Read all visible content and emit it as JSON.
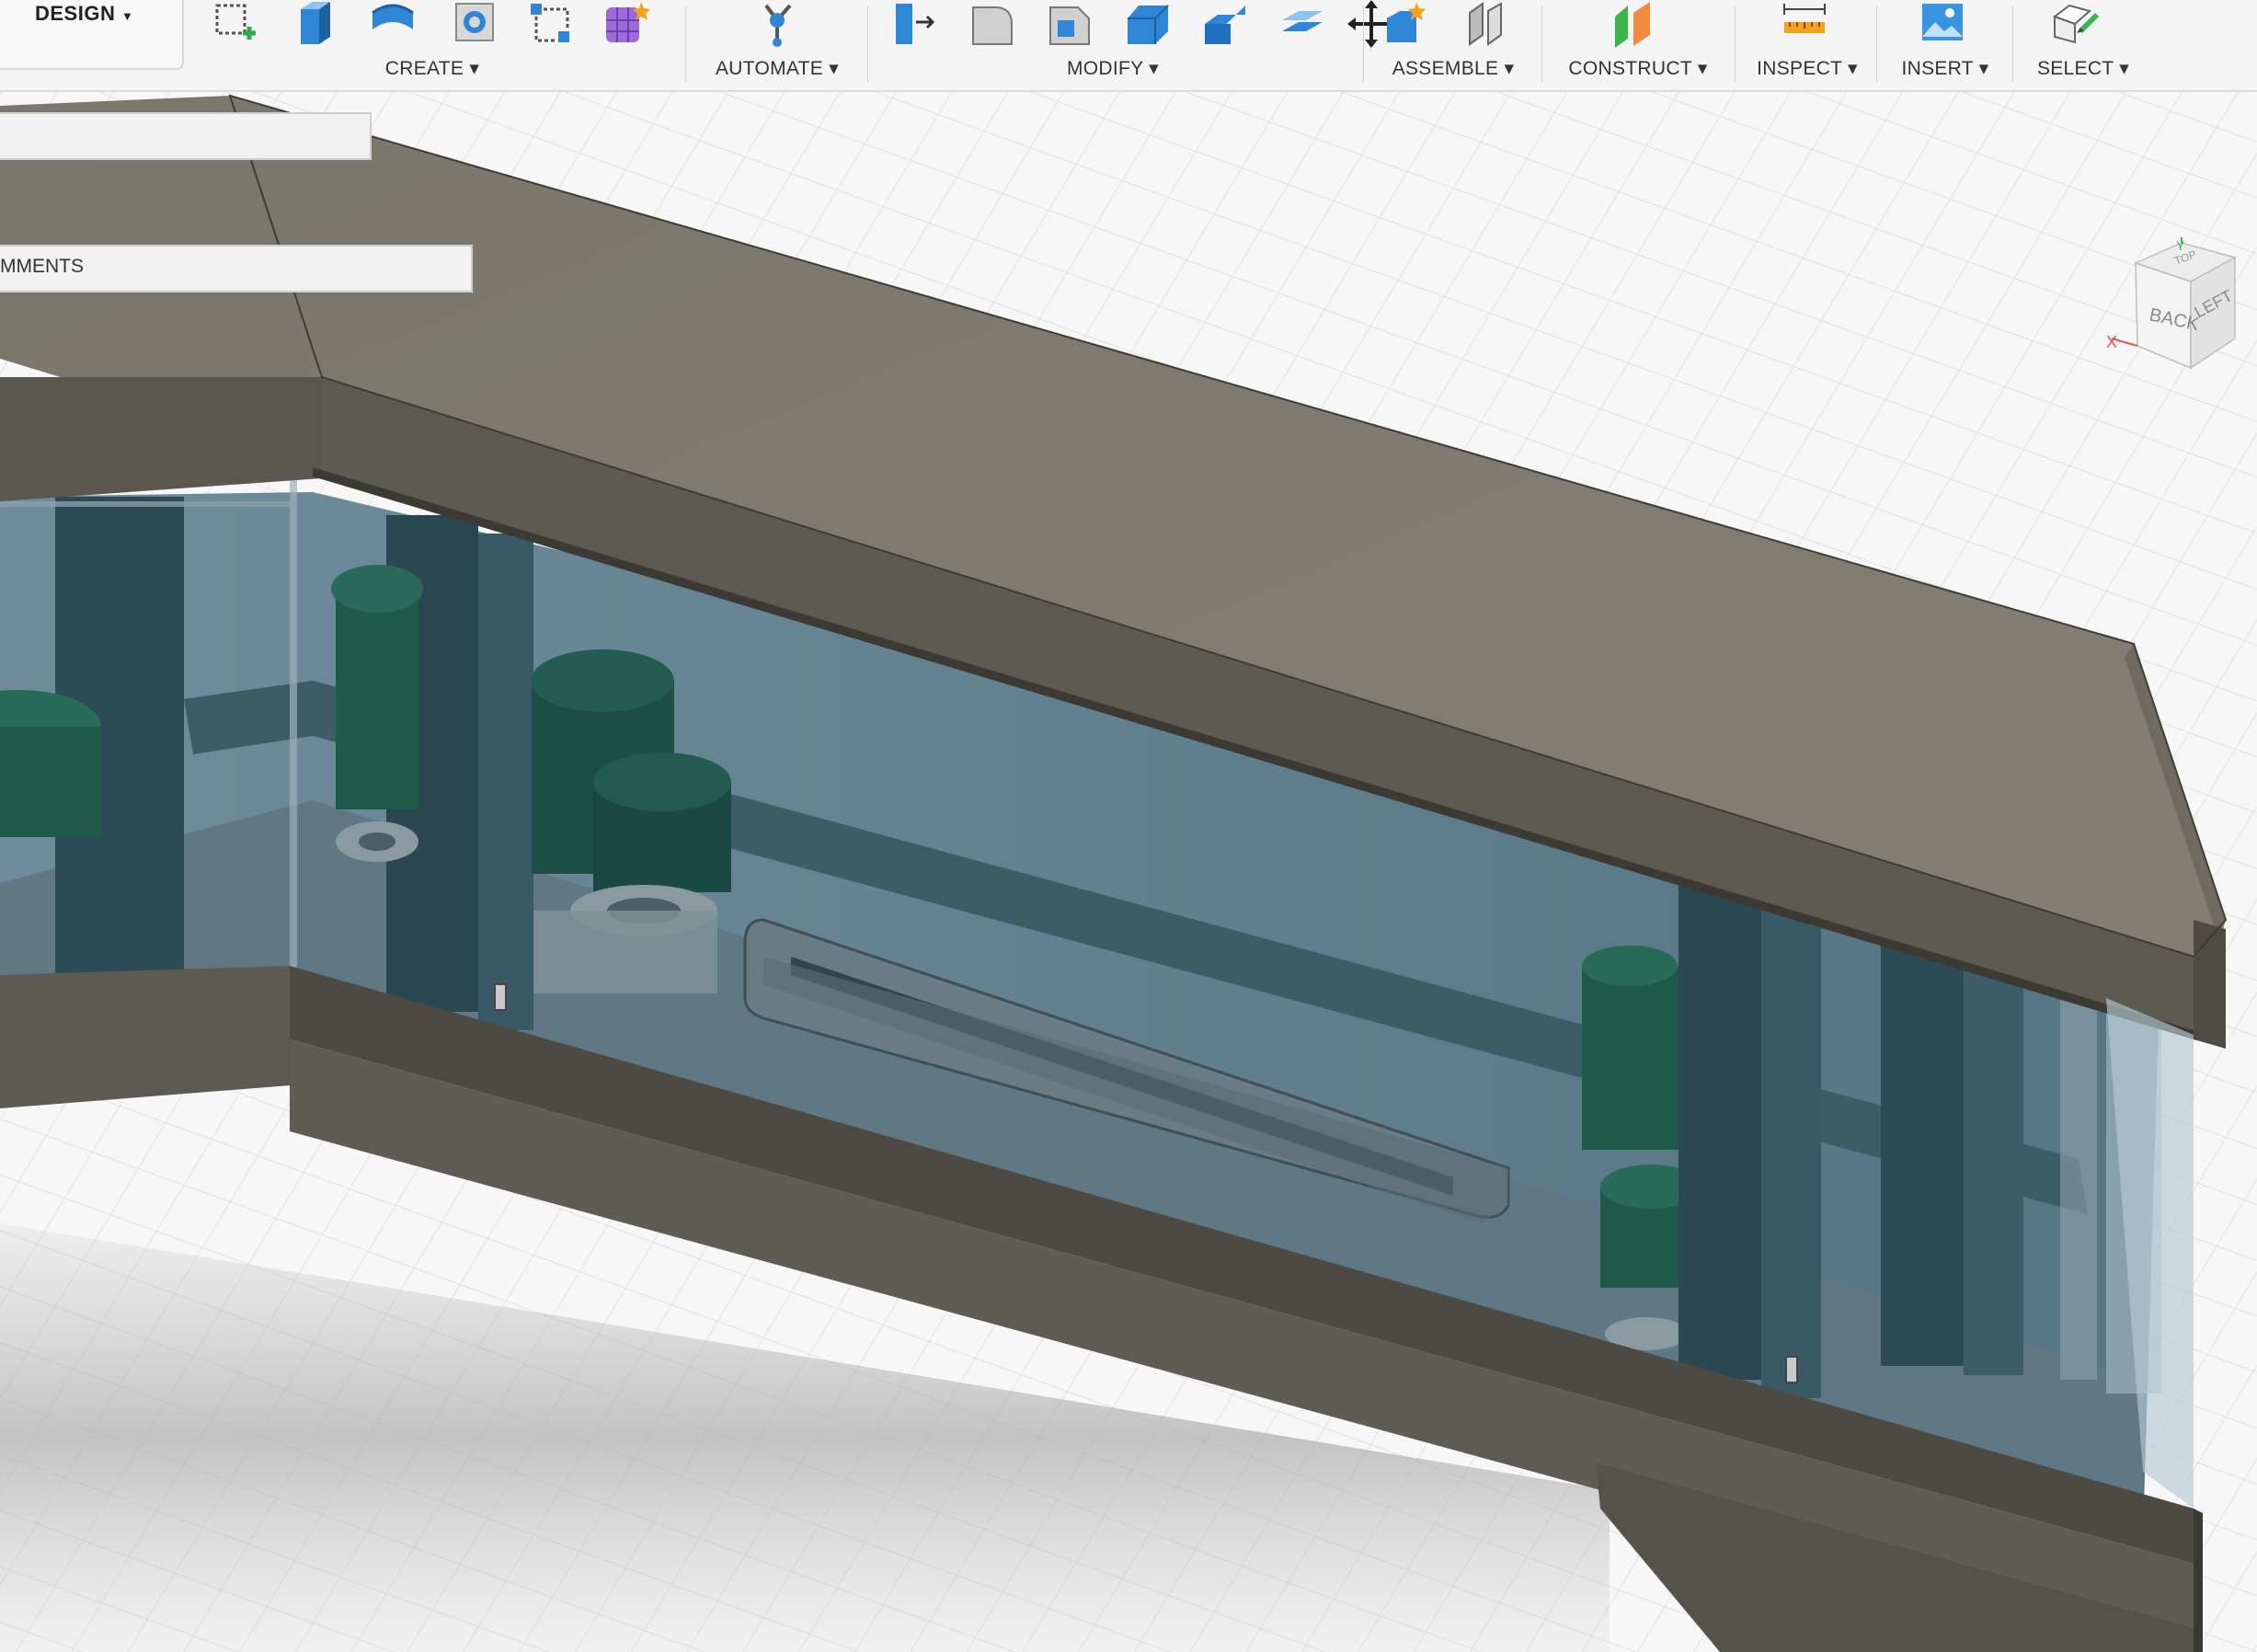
{
  "workspace": {
    "label": "DESIGN"
  },
  "toolbar": {
    "groups": [
      {
        "label": "CREATE"
      },
      {
        "label": "AUTOMATE"
      },
      {
        "label": "MODIFY"
      },
      {
        "label": "ASSEMBLE"
      },
      {
        "label": "CONSTRUCT"
      },
      {
        "label": "INSPECT"
      },
      {
        "label": "INSERT"
      },
      {
        "label": "SELECT"
      }
    ]
  },
  "browser": {
    "rows": [
      {
        "label": ""
      },
      {
        "label": "MMENTS"
      }
    ]
  },
  "viewcube": {
    "face_back": "BACK",
    "face_left": "LEFT",
    "face_top": "TOP",
    "axis_x": "X",
    "axis_y": "Y"
  },
  "colors": {
    "accent_blue": "#2f86d6",
    "model_top": "#7e7b6f",
    "model_side": "#5b5850",
    "glass": "#5d7c8c",
    "canister": "#1f5a52"
  }
}
